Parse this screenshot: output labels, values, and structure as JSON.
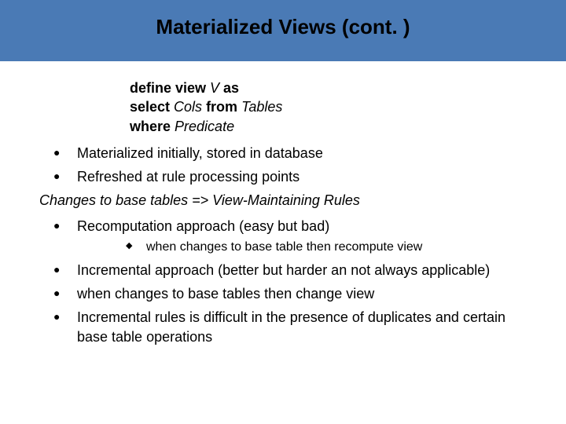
{
  "title": "Materialized Views (cont. )",
  "definition": {
    "line1_kw1": "define view",
    "line1_var": " V ",
    "line1_kw2": "as",
    "line2_kw1": "select ",
    "line2_var1": "Cols ",
    "line2_kw2": "from ",
    "line2_var2": "Tables",
    "line3_kw1": "where",
    "line3_var": " Predicate"
  },
  "bullets": {
    "b1": "Materialized initially, stored in database",
    "b2": "Refreshed at rule processing points",
    "plain": "Changes to base tables => View-Maintaining Rules",
    "b3": "Recomputation approach (easy but bad)",
    "s1": "when changes to base table then recompute view",
    "b4": "Incremental approach (better but harder an not always applicable)",
    "b5": "when changes to base tables then change view",
    "b6": "Incremental rules is  difficult in the presence of  duplicates  and certain base table operations"
  }
}
